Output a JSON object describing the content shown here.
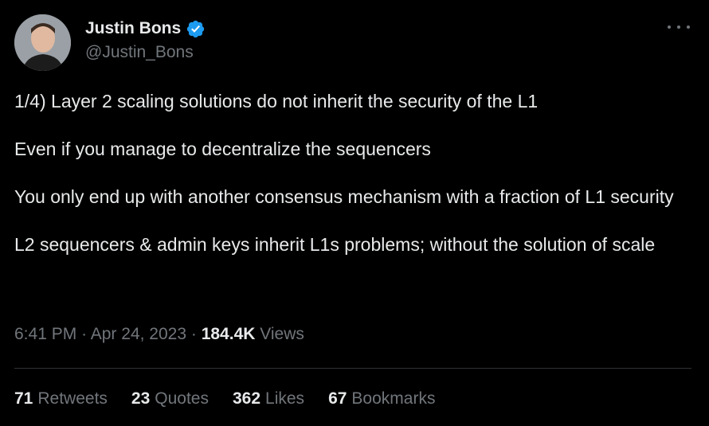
{
  "author": {
    "display_name": "Justin Bons",
    "handle": "@Justin_Bons",
    "verified": true,
    "verified_color": "#1d9bf0"
  },
  "tweet": {
    "paragraphs": [
      "1/4) Layer 2 scaling solutions do not inherit the security of the L1",
      "Even if you manage to decentralize the sequencers",
      "You only end up with another consensus mechanism with a fraction of L1 security",
      "L2 sequencers & admin keys inherit L1s problems; without the solution of scale"
    ]
  },
  "meta": {
    "time": "6:41 PM",
    "separator": "·",
    "date": "Apr 24, 2023",
    "views_count": "184.4K",
    "views_label": "Views"
  },
  "stats": {
    "retweets": {
      "count": "71",
      "label": "Retweets"
    },
    "quotes": {
      "count": "23",
      "label": "Quotes"
    },
    "likes": {
      "count": "362",
      "label": "Likes"
    },
    "bookmarks": {
      "count": "67",
      "label": "Bookmarks"
    }
  },
  "icons": {
    "more": "more-horizontal-icon",
    "verified": "verified-badge-icon"
  }
}
